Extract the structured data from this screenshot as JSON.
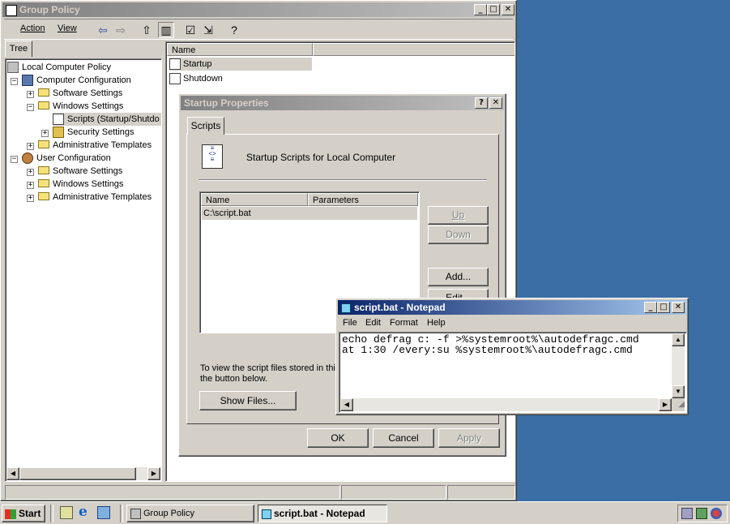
{
  "main_window": {
    "title": "Group Policy",
    "menu": [
      "Action",
      "View"
    ],
    "tree_tab": "Tree",
    "list_header": "Name",
    "list_items": [
      "Startup",
      "Shutdown"
    ],
    "tree": [
      {
        "label": "Local Computer Policy"
      },
      {
        "label": "Computer Configuration"
      },
      {
        "label": "Software Settings"
      },
      {
        "label": "Windows Settings"
      },
      {
        "label": "Scripts (Startup/Shutdo"
      },
      {
        "label": "Security Settings"
      },
      {
        "label": "Administrative Templates"
      },
      {
        "label": "User Configuration"
      },
      {
        "label": "Software Settings"
      },
      {
        "label": "Windows Settings"
      },
      {
        "label": "Administrative Templates"
      }
    ]
  },
  "dialog": {
    "title": "Startup Properties",
    "tab": "Scripts",
    "heading": "Startup Scripts for Local Computer",
    "columns": [
      "Name",
      "Parameters"
    ],
    "rows": [
      {
        "name": "C:\\script.bat",
        "params": ""
      }
    ],
    "buttons": {
      "up": "Up",
      "down": "Down",
      "add": "Add...",
      "edit": "Edit...",
      "show_files": "Show Files...",
      "ok": "OK",
      "cancel": "Cancel",
      "apply": "Apply"
    },
    "info_text": "To view the script files stored in this",
    "info_text2": "the button below."
  },
  "notepad": {
    "title": "script.bat - Notepad",
    "menu": [
      "File",
      "Edit",
      "Format",
      "Help"
    ],
    "lines": [
      "echo defrag c: -f >%systemroot%\\autodefragc.cmd",
      "at 1:30 /every:su %systemroot%\\autodefragc.cmd"
    ]
  },
  "taskbar": {
    "start": "Start",
    "tasks": [
      "Group Policy",
      "script.bat - Notepad"
    ]
  }
}
